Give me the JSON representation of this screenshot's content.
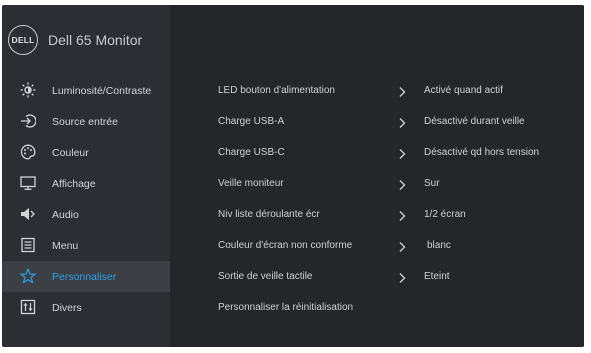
{
  "header": {
    "brand_logo": "DELL",
    "title": "Dell 65 Monitor"
  },
  "sidebar": {
    "items": [
      {
        "label": "Luminosité/Contraste",
        "icon": "brightness-icon"
      },
      {
        "label": "Source entrée",
        "icon": "input-source-icon"
      },
      {
        "label": "Couleur",
        "icon": "color-palette-icon"
      },
      {
        "label": "Affichage",
        "icon": "display-icon"
      },
      {
        "label": "Audio",
        "icon": "speaker-icon"
      },
      {
        "label": "Menu",
        "icon": "menu-icon"
      },
      {
        "label": "Personnaliser",
        "icon": "star-icon",
        "active": true
      },
      {
        "label": "Divers",
        "icon": "others-icon"
      }
    ]
  },
  "settings": {
    "rows": [
      {
        "name": "LED bouton d'alimentation",
        "value": "Activé quand actif",
        "has_chevron": true
      },
      {
        "name": "Charge USB-A",
        "value": "Désactivé durant veille",
        "has_chevron": true
      },
      {
        "name": "Charge USB-C",
        "value": "Désactivé qd hors tension",
        "has_chevron": true
      },
      {
        "name": "Veille moniteur",
        "value": "Sur",
        "has_chevron": true
      },
      {
        "name": "Niv liste déroulante écr",
        "value": "1/2 écran",
        "has_chevron": true
      },
      {
        "name": "Couleur d'écran non conforme",
        "value": "blanc",
        "has_chevron": true
      },
      {
        "name": "Sortie de veille tactile",
        "value": "Eteint",
        "has_chevron": true
      },
      {
        "name": "Personnaliser la réinitialisation",
        "value": "",
        "has_chevron": false
      }
    ]
  },
  "colors": {
    "panel": "#26282c",
    "sidebar": "#2c2e33",
    "active_bg": "#3c3f45",
    "accent": "#2f9ee3",
    "text": "#d2d4d8"
  }
}
